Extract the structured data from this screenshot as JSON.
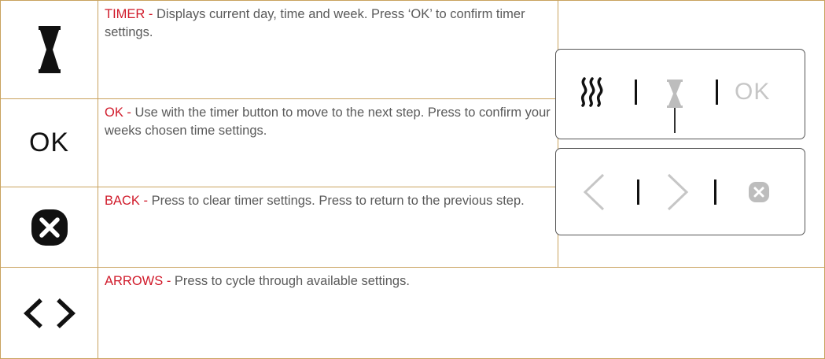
{
  "rows": [
    {
      "id": "timer",
      "keyword": "TIMER",
      "separator": " - ",
      "description": "Displays current day, time and week. Press ‘OK’ to confirm timer settings.",
      "icon": "hourglass-icon"
    },
    {
      "id": "ok",
      "keyword": "OK",
      "separator": " - ",
      "description": "Use with the timer button to move to the next step. Press to confirm your weeks chosen time settings.",
      "icon": "ok-text-icon",
      "icon_text": "OK"
    },
    {
      "id": "back",
      "keyword": "BACK",
      "separator": " - ",
      "description": "Press to clear timer settings. Press to return to the previous step.",
      "icon": "close-circle-icon"
    },
    {
      "id": "arrows",
      "keyword": "ARROWS",
      "separator": " - ",
      "description": "Press to cycle through available settings.",
      "icon": "chevron-left-right-icon"
    }
  ],
  "panel": {
    "top_ok_label": "OK",
    "top_icons": [
      "heat-waves-icon",
      "hourglass-icon",
      "ok-text-icon"
    ],
    "bottom_icons": [
      "chevron-left-icon",
      "chevron-right-icon",
      "close-circle-icon"
    ]
  },
  "colors": {
    "border": "#c9a25e",
    "keyword": "#d01a2a",
    "text": "#5a5a5a",
    "icon_dark": "#111111",
    "icon_light": "#c6c6c6"
  }
}
